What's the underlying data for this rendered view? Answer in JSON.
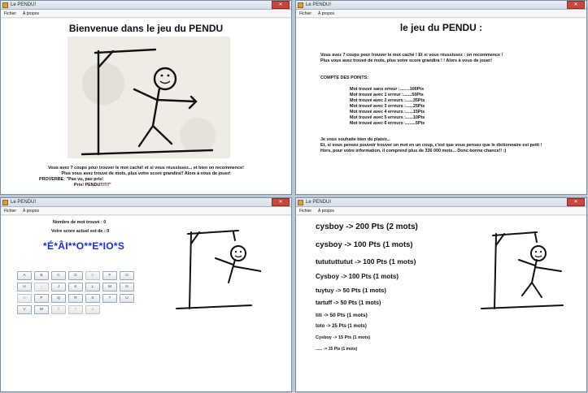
{
  "windows": [
    {
      "title": "Le PENDU!",
      "menu": [
        "Fichier",
        "À propos"
      ]
    },
    {
      "title": "Le PENDU!",
      "menu": [
        "Fichier",
        "À propos"
      ]
    },
    {
      "title": "Le PENDU!",
      "menu": [
        "Fichier",
        "À propos"
      ]
    },
    {
      "title": "Le PENDU!",
      "menu": [
        "Fichier",
        "À propos"
      ]
    }
  ],
  "welcome": {
    "title": "Bienvenue dans le jeu du PENDU",
    "line1": "Vous avez 7 coups pour trouver le mot caché! et si vous réussissez... et bien on recommence!",
    "line2": "Plus vous avez trouvé de mots, plus votre score grandira!! Alors à vous de jouer!",
    "line3": "PROVERBE:   \"Pas vu, pas pris!",
    "line4": "Pris! PENDU!!!!!!\""
  },
  "rules": {
    "title": "le jeu du PENDU :",
    "intro1": "Vous avez 7 coups pour trouver le mot caché ! Et si vous réussissez : on recommence !",
    "intro2": "Plus vous avez trouvé de mots, plus votre score grandira ! ! Alors à vous de jouer!",
    "points_title": "COMPTE DES POINTS:",
    "points": [
      "Mot trouvé sans erreur :........100Pts",
      "Mot trouvé avec 1 erreur :.......50Pts",
      "Mot trouvé avec 2 erreurs :......35Pts",
      "Mot trouvé avec 3 erreurs :......25Pts",
      "Mot trouvé avec 4 erreurs :......15Pts",
      "Mot trouvé avec 5 erreurs :......10Pts",
      "Mot trouvé avec 6 erreurs :........5Pts"
    ],
    "outro1": "Je vous souhaite bien du plaisir...",
    "outro2": "Et, si vous pensez pouvoir trouver un mot en un coup, c'est que vous pensez que le dictionnaire est petit !",
    "outro3": "Hors, pour votre information, il comprend plus de 336 000 mots... Donc bonne chance!! :)"
  },
  "game": {
    "found_label": "Nombre de mot trouvé : 0",
    "score_label": "Votre score actuel est de : 0",
    "masked_word": "*É*ÂI**O**E*IO*S",
    "keys": [
      {
        "k": "A",
        "d": false
      },
      {
        "k": "B",
        "d": false
      },
      {
        "k": "C",
        "d": false
      },
      {
        "k": "D",
        "d": false
      },
      {
        "k": "E",
        "d": true
      },
      {
        "k": "F",
        "d": false
      },
      {
        "k": "G",
        "d": false
      },
      {
        "k": "H",
        "d": false
      },
      {
        "k": "I",
        "d": true
      },
      {
        "k": "J",
        "d": false
      },
      {
        "k": "K",
        "d": false
      },
      {
        "k": "L",
        "d": false
      },
      {
        "k": "M",
        "d": false
      },
      {
        "k": "N",
        "d": false
      },
      {
        "k": "O",
        "d": true
      },
      {
        "k": "P",
        "d": false
      },
      {
        "k": "Q",
        "d": false
      },
      {
        "k": "R",
        "d": false
      },
      {
        "k": "S",
        "d": false
      },
      {
        "k": "T",
        "d": false
      },
      {
        "k": "U",
        "d": false
      },
      {
        "k": "V",
        "d": false
      },
      {
        "k": "W",
        "d": false
      },
      {
        "k": "X",
        "d": true
      },
      {
        "k": "Y",
        "d": true
      },
      {
        "k": "Z",
        "d": true
      }
    ]
  },
  "scores": [
    {
      "text": "cysboy -> 200 Pts  (2 mots)",
      "size": 10
    },
    {
      "text": "cysboy -> 100 Pts  (1 mots)",
      "size": 9.5
    },
    {
      "text": "tutututtutut -> 100 Pts  (1 mots)",
      "size": 8.5
    },
    {
      "text": "Cysboy -> 100 Pts  (1 mots)",
      "size": 8
    },
    {
      "text": "tuytuy -> 50 Pts  (1 mots)",
      "size": 7.5
    },
    {
      "text": "tartuff -> 50 Pts  (1 mots)",
      "size": 7
    },
    {
      "text": "titi -> 50 Pts  (1 mots)",
      "size": 6.5
    },
    {
      "text": "toto -> 25 Pts  (1 mots)",
      "size": 6
    },
    {
      "text": "Cysboy -> 15 Pts  (1 mots)",
      "size": 5.5
    },
    {
      "text": "...... -> 15 Pts  (1 mots)",
      "size": 5
    }
  ]
}
